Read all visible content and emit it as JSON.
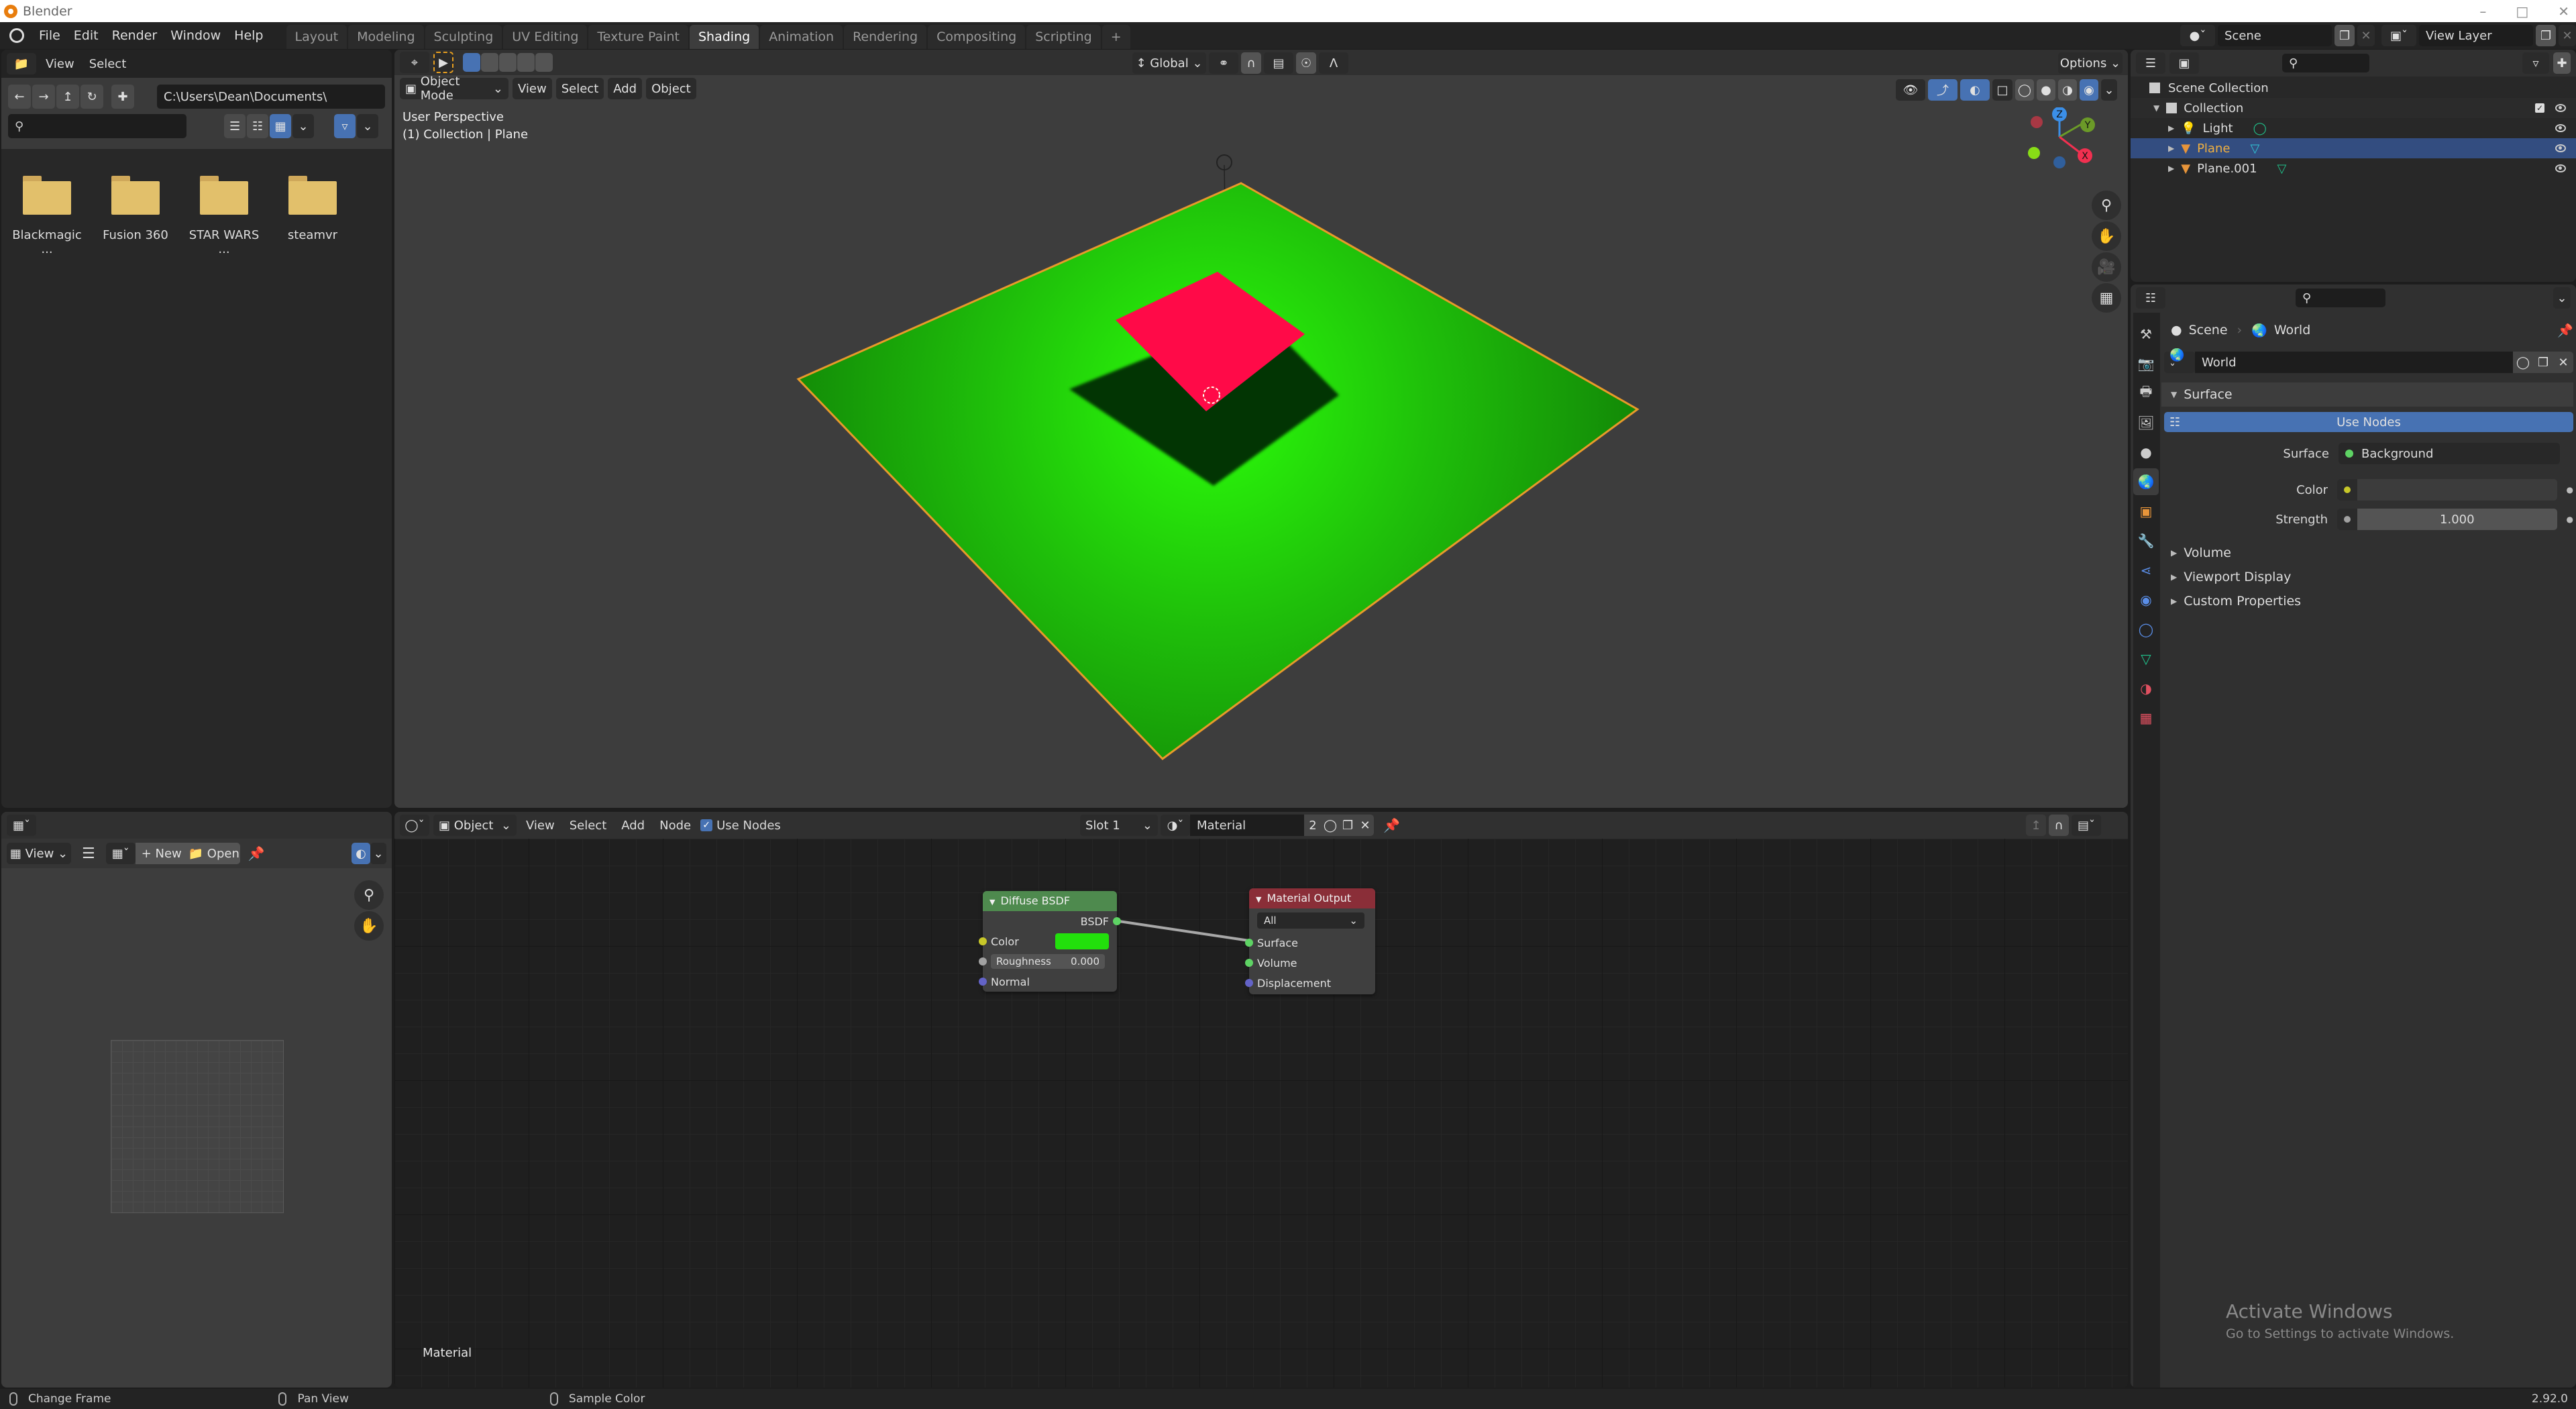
{
  "window": {
    "title": "Blender",
    "controls": [
      "minimize",
      "maximize",
      "close"
    ]
  },
  "topbar": {
    "menus": [
      "File",
      "Edit",
      "Render",
      "Window",
      "Help"
    ],
    "workspaces": [
      "Layout",
      "Modeling",
      "Sculpting",
      "UV Editing",
      "Texture Paint",
      "Shading",
      "Animation",
      "Rendering",
      "Compositing",
      "Scripting"
    ],
    "active_workspace": "Shading",
    "add_workspace": "+",
    "scene": "Scene",
    "view_layer": "View Layer"
  },
  "file_browser": {
    "menus": [
      "View",
      "Select"
    ],
    "path": "C:\\Users\\Dean\\Documents\\",
    "search_placeholder": "",
    "items": [
      {
        "name": "Blackmagic ...",
        "type": "folder"
      },
      {
        "name": "Fusion 360",
        "type": "folder"
      },
      {
        "name": "STAR WARS ...",
        "type": "folder"
      },
      {
        "name": "steamvr",
        "type": "folder"
      }
    ]
  },
  "viewport": {
    "mode": "Object Mode",
    "menus": [
      "View",
      "Select",
      "Add",
      "Object"
    ],
    "transform_orientation": "Global",
    "options_label": "Options",
    "overlay_title": "User Perspective",
    "overlay_sub": "(1) Collection | Plane",
    "gizmo_axes": [
      "X",
      "Y",
      "Z"
    ],
    "colors": {
      "floor": "#22c40c",
      "floor_edge": "#e89a2a",
      "plane_top": "#ff0a48",
      "shadow": "#023503"
    }
  },
  "outliner": {
    "root": "Scene Collection",
    "collection": "Collection",
    "items": [
      {
        "name": "Light",
        "type": "light",
        "selected": false
      },
      {
        "name": "Plane",
        "type": "mesh",
        "selected": true
      },
      {
        "name": "Plane.001",
        "type": "mesh",
        "selected": false
      }
    ]
  },
  "properties": {
    "breadcrumb": [
      "Scene",
      "World"
    ],
    "world_name": "World",
    "sections": {
      "surface": "Surface",
      "use_nodes": "Use Nodes",
      "surface_label": "Surface",
      "surface_value": "Background",
      "color_label": "Color",
      "strength_label": "Strength",
      "strength_value": "1.000",
      "volume": "Volume",
      "viewport_display": "Viewport Display",
      "custom_properties": "Custom Properties"
    },
    "tabs": [
      "tool",
      "render",
      "output",
      "view-layer",
      "scene",
      "world",
      "object",
      "modifiers",
      "particles",
      "physics",
      "constraints",
      "data",
      "material",
      "texture"
    ],
    "active_tab": "world"
  },
  "image_editor": {
    "view_label": "View",
    "new_label": "New",
    "open_label": "Open"
  },
  "node_editor": {
    "object_label": "Object",
    "menus": [
      "View",
      "Select",
      "Add",
      "Node"
    ],
    "use_nodes_label": "Use Nodes",
    "use_nodes_checked": true,
    "slot": "Slot 1",
    "material": "Material",
    "users": "2",
    "tree_label": "Material",
    "nodes": {
      "diffuse": {
        "title": "Diffuse BSDF",
        "output": "BSDF",
        "color_label": "Color",
        "color_value": "#22e00c",
        "roughness_label": "Roughness",
        "roughness_value": "0.000",
        "normal_label": "Normal"
      },
      "output": {
        "title": "Material Output",
        "target": "All",
        "inputs": [
          "Surface",
          "Volume",
          "Displacement"
        ]
      }
    }
  },
  "statusbar": {
    "hints": [
      "Change Frame",
      "Pan View",
      "Sample Color"
    ],
    "version": "2.92.0"
  },
  "watermark": {
    "title": "Activate Windows",
    "subtitle": "Go to Settings to activate Windows."
  }
}
